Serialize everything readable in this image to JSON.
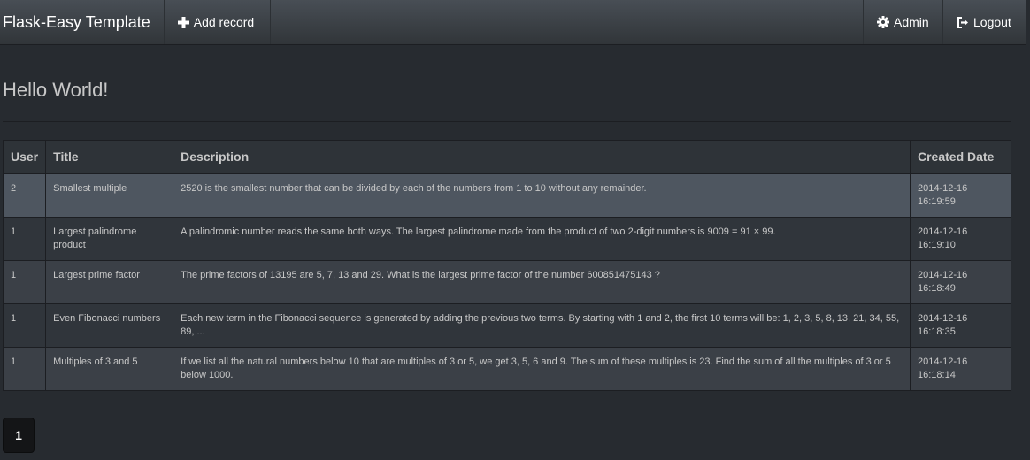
{
  "navbar": {
    "brand": "Flask-Easy Template",
    "add_record": "Add record",
    "admin": "Admin",
    "logout": "Logout"
  },
  "page": {
    "title": "Hello World!"
  },
  "table": {
    "columns": [
      "User",
      "Title",
      "Description",
      "Created Date"
    ],
    "rows": [
      {
        "user": "2",
        "title": "Smallest multiple",
        "description": "2520 is the smallest number that can be divided by each of the numbers from 1 to 10 without any remainder.",
        "date": "2014-12-16",
        "time": "16:19:59"
      },
      {
        "user": "1",
        "title": "Largest palindrome product",
        "description": "A palindromic number reads the same both ways. The largest palindrome made from the product of two 2-digit numbers is 9009 = 91 × 99.",
        "date": "2014-12-16",
        "time": "16:19:10"
      },
      {
        "user": "1",
        "title": "Largest prime factor",
        "description": "The prime factors of 13195 are 5, 7, 13 and 29. What is the largest prime factor of the number 600851475143 ?",
        "date": "2014-12-16",
        "time": "16:18:49"
      },
      {
        "user": "1",
        "title": "Even Fibonacci numbers",
        "description": "Each new term in the Fibonacci sequence is generated by adding the previous two terms. By starting with 1 and 2, the first 10 terms will be: 1, 2, 3, 5, 8, 13, 21, 34, 55, 89, ...",
        "date": "2014-12-16",
        "time": "16:18:35"
      },
      {
        "user": "1",
        "title": "Multiples of 3 and 5",
        "description": "If we list all the natural numbers below 10 that are multiples of 3 or 5, we get 3, 5, 6 and 9. The sum of these multiples is 23. Find the sum of all the multiples of 3 or 5 below 1000.",
        "date": "2014-12-16",
        "time": "16:18:14"
      }
    ]
  },
  "pagination": {
    "current_page": "1"
  },
  "icons": {
    "add": "plus-icon",
    "admin": "gear-icon",
    "logout": "logout-icon"
  }
}
